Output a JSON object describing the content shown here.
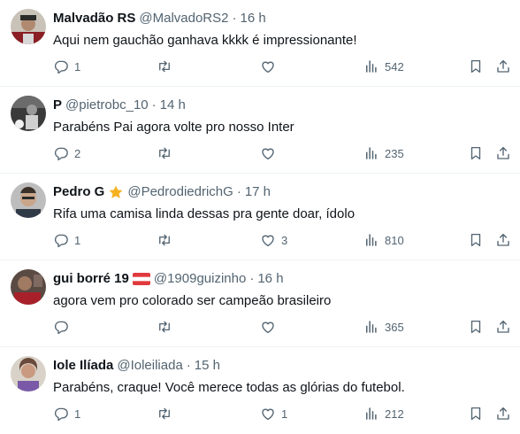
{
  "colors": {
    "text": "#0f1419",
    "secondary": "#536471",
    "divider": "#eff3f4",
    "star": "#f5b120"
  },
  "tweets": [
    {
      "name": "Malvadão RS",
      "handle": "@MalvadoRS2",
      "separator": "·",
      "time": "16 h",
      "text": "Aqui nem gauchão ganhava kkkk é impressionante!",
      "replies": "1",
      "retweets": "",
      "likes": "",
      "views": "542"
    },
    {
      "name": "P",
      "handle": "@pietrobc_10",
      "separator": "·",
      "time": "14 h",
      "text": "Parabéns Pai agora volte pro nosso Inter",
      "replies": "2",
      "retweets": "",
      "likes": "",
      "views": "235"
    },
    {
      "name": "Pedro G",
      "badge": "star-icon",
      "handle": "@PedrodiedrichG",
      "separator": "·",
      "time": "17 h",
      "text": "Rifa uma camisa linda dessas pra gente doar, ídolo",
      "replies": "1",
      "retweets": "",
      "likes": "3",
      "views": "810"
    },
    {
      "name": "gui borré 19",
      "badge": "austria-flag-icon",
      "handle": "@1909guizinho",
      "separator": "·",
      "time": "16 h",
      "text": "agora vem pro colorado ser campeão brasileiro",
      "replies": "",
      "retweets": "",
      "likes": "",
      "views": "365"
    },
    {
      "name": "Iole Ilíada",
      "handle": "@Ioleiliada",
      "separator": "·",
      "time": "15 h",
      "text": "Parabéns, craque! Você merece todas as glórias do futebol.",
      "replies": "1",
      "retweets": "",
      "likes": "1",
      "views": "212"
    }
  ]
}
